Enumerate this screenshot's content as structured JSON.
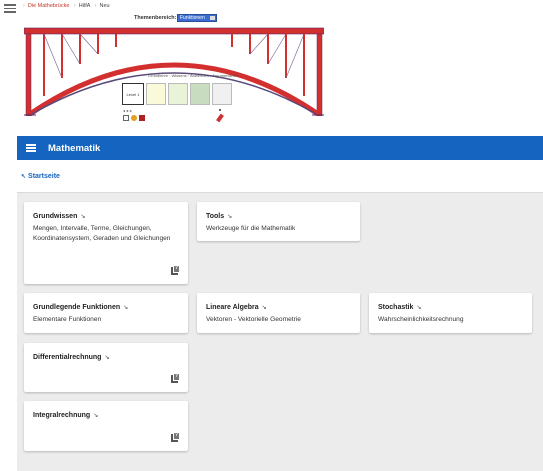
{
  "top": {
    "breadcrumb": {
      "first": "Die Mathebrücke",
      "second": "HilfA",
      "third": "Neu"
    },
    "theme_label": "Themenbereich:",
    "theme_selected": "Funktionen",
    "links": "Grundlehre · Wissens · Anwenden · Argumentieren",
    "level_label": "Level 1"
  },
  "appbar": {
    "title": "Mathematik"
  },
  "breadcrumb": {
    "home": "Startseite"
  },
  "colors": {
    "appbar": "#1565c0",
    "link": "#1565c0",
    "bridge": "#d32f2f"
  },
  "cards": [
    {
      "title": "Grundwissen",
      "desc": "Mengen, Intervalle, Terme, Gleichungen, Koordinatensystem, Geraden und Gleichungen",
      "icon": "help-book-icon"
    },
    {
      "title": "Tools",
      "desc": "Werkzeuge für die Mathematik"
    },
    {
      "title": "Grundlegende Funktionen",
      "desc": "Elementare Funktionen"
    },
    {
      "title": "Lineare Algebra",
      "desc": "Vektoren - Vektorielle Geometrie"
    },
    {
      "title": "Stochastik",
      "desc": "Wahrscheinlichkeitsrechnung"
    },
    {
      "title": "Differentialrechnung",
      "desc": "",
      "icon": "help-book-icon"
    },
    {
      "title": "Integralrechnung",
      "desc": "",
      "icon": "help-book-icon"
    }
  ]
}
